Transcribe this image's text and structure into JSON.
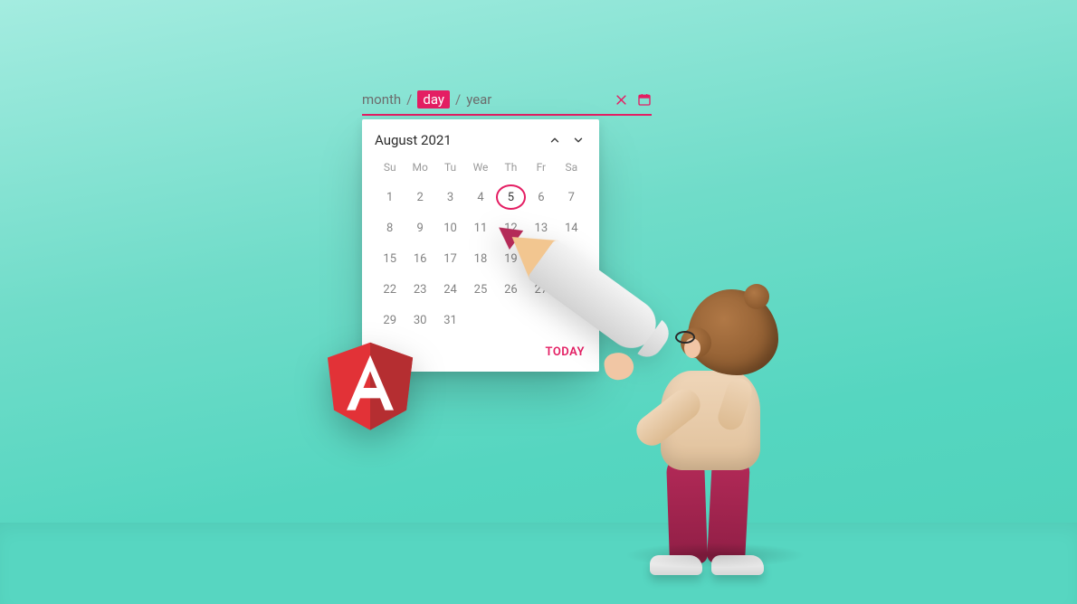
{
  "input": {
    "month_label": "month",
    "day_label": "day",
    "year_label": "year",
    "selected_segment": "day"
  },
  "calendar": {
    "title": "August 2021",
    "daysOfWeek": [
      "Su",
      "Mo",
      "Tu",
      "We",
      "Th",
      "Fr",
      "Sa"
    ],
    "firstDayOffset": 0,
    "daysInMonth": 31,
    "selectedDay": 5,
    "todayLabel": "TODAY"
  },
  "icons": {
    "clear": "close-icon",
    "picker": "calendar-icon",
    "prev": "chevron-up-icon",
    "next": "chevron-down-icon",
    "shield_letter": "A"
  },
  "colors": {
    "accent": "#e41e63",
    "angular_red": "#e23237",
    "angular_dark": "#b52e31"
  }
}
